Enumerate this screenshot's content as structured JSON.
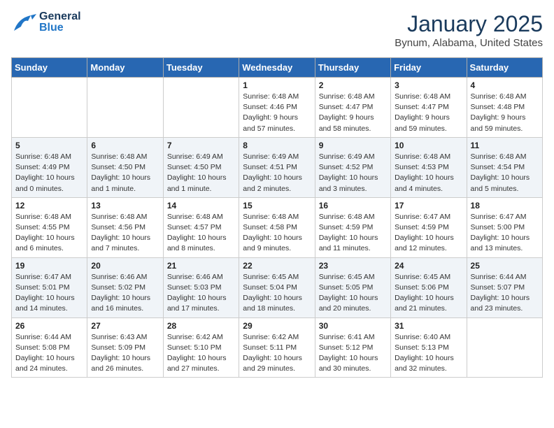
{
  "logo": {
    "line1": "General",
    "line2": "Blue"
  },
  "title": "January 2025",
  "location": "Bynum, Alabama, United States",
  "weekdays": [
    "Sunday",
    "Monday",
    "Tuesday",
    "Wednesday",
    "Thursday",
    "Friday",
    "Saturday"
  ],
  "weeks": [
    [
      {
        "day": "",
        "info": ""
      },
      {
        "day": "",
        "info": ""
      },
      {
        "day": "",
        "info": ""
      },
      {
        "day": "1",
        "info": "Sunrise: 6:48 AM\nSunset: 4:46 PM\nDaylight: 9 hours and 57 minutes."
      },
      {
        "day": "2",
        "info": "Sunrise: 6:48 AM\nSunset: 4:47 PM\nDaylight: 9 hours and 58 minutes."
      },
      {
        "day": "3",
        "info": "Sunrise: 6:48 AM\nSunset: 4:47 PM\nDaylight: 9 hours and 59 minutes."
      },
      {
        "day": "4",
        "info": "Sunrise: 6:48 AM\nSunset: 4:48 PM\nDaylight: 9 hours and 59 minutes."
      }
    ],
    [
      {
        "day": "5",
        "info": "Sunrise: 6:48 AM\nSunset: 4:49 PM\nDaylight: 10 hours and 0 minutes."
      },
      {
        "day": "6",
        "info": "Sunrise: 6:48 AM\nSunset: 4:50 PM\nDaylight: 10 hours and 1 minute."
      },
      {
        "day": "7",
        "info": "Sunrise: 6:49 AM\nSunset: 4:50 PM\nDaylight: 10 hours and 1 minute."
      },
      {
        "day": "8",
        "info": "Sunrise: 6:49 AM\nSunset: 4:51 PM\nDaylight: 10 hours and 2 minutes."
      },
      {
        "day": "9",
        "info": "Sunrise: 6:49 AM\nSunset: 4:52 PM\nDaylight: 10 hours and 3 minutes."
      },
      {
        "day": "10",
        "info": "Sunrise: 6:48 AM\nSunset: 4:53 PM\nDaylight: 10 hours and 4 minutes."
      },
      {
        "day": "11",
        "info": "Sunrise: 6:48 AM\nSunset: 4:54 PM\nDaylight: 10 hours and 5 minutes."
      }
    ],
    [
      {
        "day": "12",
        "info": "Sunrise: 6:48 AM\nSunset: 4:55 PM\nDaylight: 10 hours and 6 minutes."
      },
      {
        "day": "13",
        "info": "Sunrise: 6:48 AM\nSunset: 4:56 PM\nDaylight: 10 hours and 7 minutes."
      },
      {
        "day": "14",
        "info": "Sunrise: 6:48 AM\nSunset: 4:57 PM\nDaylight: 10 hours and 8 minutes."
      },
      {
        "day": "15",
        "info": "Sunrise: 6:48 AM\nSunset: 4:58 PM\nDaylight: 10 hours and 9 minutes."
      },
      {
        "day": "16",
        "info": "Sunrise: 6:48 AM\nSunset: 4:59 PM\nDaylight: 10 hours and 11 minutes."
      },
      {
        "day": "17",
        "info": "Sunrise: 6:47 AM\nSunset: 4:59 PM\nDaylight: 10 hours and 12 minutes."
      },
      {
        "day": "18",
        "info": "Sunrise: 6:47 AM\nSunset: 5:00 PM\nDaylight: 10 hours and 13 minutes."
      }
    ],
    [
      {
        "day": "19",
        "info": "Sunrise: 6:47 AM\nSunset: 5:01 PM\nDaylight: 10 hours and 14 minutes."
      },
      {
        "day": "20",
        "info": "Sunrise: 6:46 AM\nSunset: 5:02 PM\nDaylight: 10 hours and 16 minutes."
      },
      {
        "day": "21",
        "info": "Sunrise: 6:46 AM\nSunset: 5:03 PM\nDaylight: 10 hours and 17 minutes."
      },
      {
        "day": "22",
        "info": "Sunrise: 6:45 AM\nSunset: 5:04 PM\nDaylight: 10 hours and 18 minutes."
      },
      {
        "day": "23",
        "info": "Sunrise: 6:45 AM\nSunset: 5:05 PM\nDaylight: 10 hours and 20 minutes."
      },
      {
        "day": "24",
        "info": "Sunrise: 6:45 AM\nSunset: 5:06 PM\nDaylight: 10 hours and 21 minutes."
      },
      {
        "day": "25",
        "info": "Sunrise: 6:44 AM\nSunset: 5:07 PM\nDaylight: 10 hours and 23 minutes."
      }
    ],
    [
      {
        "day": "26",
        "info": "Sunrise: 6:44 AM\nSunset: 5:08 PM\nDaylight: 10 hours and 24 minutes."
      },
      {
        "day": "27",
        "info": "Sunrise: 6:43 AM\nSunset: 5:09 PM\nDaylight: 10 hours and 26 minutes."
      },
      {
        "day": "28",
        "info": "Sunrise: 6:42 AM\nSunset: 5:10 PM\nDaylight: 10 hours and 27 minutes."
      },
      {
        "day": "29",
        "info": "Sunrise: 6:42 AM\nSunset: 5:11 PM\nDaylight: 10 hours and 29 minutes."
      },
      {
        "day": "30",
        "info": "Sunrise: 6:41 AM\nSunset: 5:12 PM\nDaylight: 10 hours and 30 minutes."
      },
      {
        "day": "31",
        "info": "Sunrise: 6:40 AM\nSunset: 5:13 PM\nDaylight: 10 hours and 32 minutes."
      },
      {
        "day": "",
        "info": ""
      }
    ]
  ]
}
